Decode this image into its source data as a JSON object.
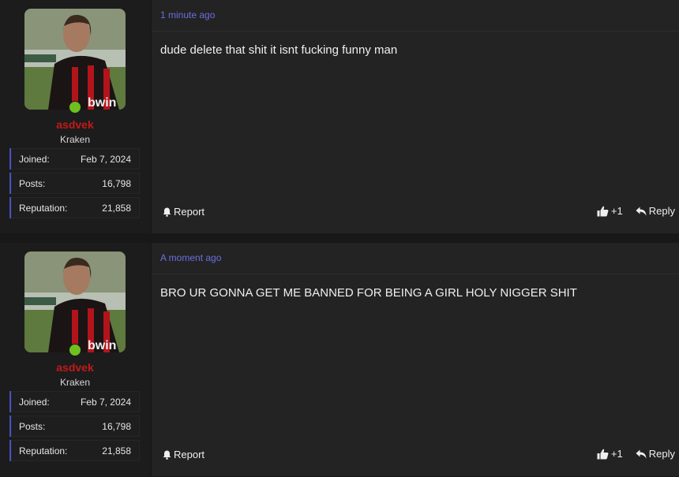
{
  "posts": [
    {
      "author": {
        "username": "asdvek",
        "title": "Kraken",
        "online": true,
        "stats": [
          {
            "label": "Joined:",
            "value": "Feb 7, 2024"
          },
          {
            "label": "Posts:",
            "value": "16,798"
          },
          {
            "label": "Reputation:",
            "value": "21,858"
          }
        ]
      },
      "timestamp": "1 minute ago",
      "message": "dude delete that shit it isnt fucking funny man",
      "actions": {
        "report": "Report",
        "like_count": "+1",
        "reply": "Reply"
      }
    },
    {
      "author": {
        "username": "asdvek",
        "title": "Kraken",
        "online": true,
        "stats": [
          {
            "label": "Joined:",
            "value": "Feb 7, 2024"
          },
          {
            "label": "Posts:",
            "value": "16,798"
          },
          {
            "label": "Reputation:",
            "value": "21,858"
          }
        ]
      },
      "timestamp": "A moment ago",
      "message": "BRO UR GONNA GET ME BANNED FOR BEING A GIRL HOLY NIGGER SHIT",
      "actions": {
        "report": "Report",
        "like_count": "+1",
        "reply": "Reply"
      }
    }
  ],
  "icons": {
    "report": "bell-icon",
    "like": "thumbs-up-icon",
    "reply": "reply-arrow-icon"
  },
  "colors": {
    "username": "#c41919",
    "timestamp": "#6b6fe0",
    "online": "#6fbf1f",
    "stat_accent": "#4a4dc6"
  }
}
